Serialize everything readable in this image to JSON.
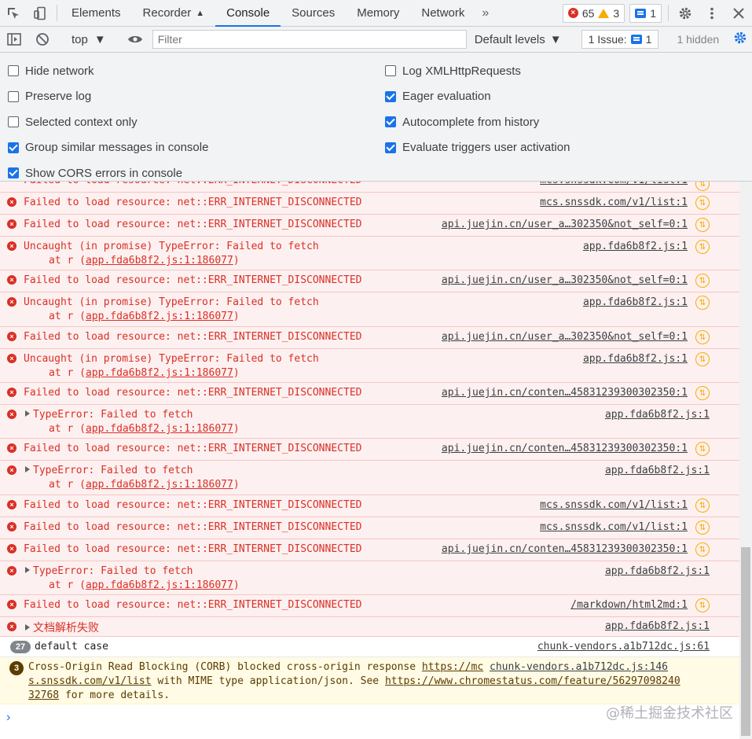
{
  "tabs": {
    "elements": "Elements",
    "recorder": "Recorder",
    "console": "Console",
    "sources": "Sources",
    "memory": "Memory",
    "network": "Network"
  },
  "counts": {
    "errors": "65",
    "warnings": "3",
    "messages": "1"
  },
  "toolbar": {
    "context": "top",
    "filter_placeholder": "Filter",
    "levels": "Default levels",
    "issue_label": "1 Issue:",
    "issue_count": "1",
    "hidden": "1 hidden"
  },
  "settings_left": [
    {
      "label": "Hide network",
      "checked": false
    },
    {
      "label": "Preserve log",
      "checked": false
    },
    {
      "label": "Selected context only",
      "checked": false
    },
    {
      "label": "Group similar messages in console",
      "checked": true
    },
    {
      "label": "Show CORS errors in console",
      "checked": true
    }
  ],
  "settings_right": [
    {
      "label": "Log XMLHttpRequests",
      "checked": false
    },
    {
      "label": "Eager evaluation",
      "checked": true
    },
    {
      "label": "Autocomplete from history",
      "checked": true
    },
    {
      "label": "Evaluate triggers user activation",
      "checked": true
    }
  ],
  "log": {
    "failed": "Failed to load resource: net::ERR_INTERNET_DISCONNECTED",
    "uncaught": "Uncaught (in promise) TypeError: Failed to fetch",
    "typeerror": "TypeError: Failed to fetch",
    "at_prefix": "at r (",
    "at_link": "app.fda6b8f2.js:1:186077",
    "at_suffix": ")",
    "src_list": "mcs.snssdk.com/v1/list:1",
    "src_user": "api.juejin.cn/user_a…302350&not_self=0:1",
    "src_app": "app.fda6b8f2.js:1",
    "src_content": "api.juejin.cn/conten…45831239300302350:1",
    "src_markdown": "/markdown/html2md:1",
    "parse_fail": "文档解析失败",
    "default_count": "27",
    "default_text": "default case",
    "default_src": "chunk-vendors.a1b712dc.js:61",
    "corb_count": "3",
    "corb_line1_a": "Cross-Origin Read Blocking (CORB) blocked cross-origin response ",
    "corb_line1_link": "https://mc",
    "corb_line1_src": "chunk-vendors.a1b712dc.js:146",
    "corb_line2_link": "s.snssdk.com/v1/list",
    "corb_line2_b": " with MIME type application/json. See ",
    "corb_line2_link2": "https://www.chromestatus.com/feature/56297098240",
    "corb_line3_link": "32768",
    "corb_line3_b": " for more details."
  },
  "watermark": "@稀土掘金技术社区",
  "prompt": "›"
}
